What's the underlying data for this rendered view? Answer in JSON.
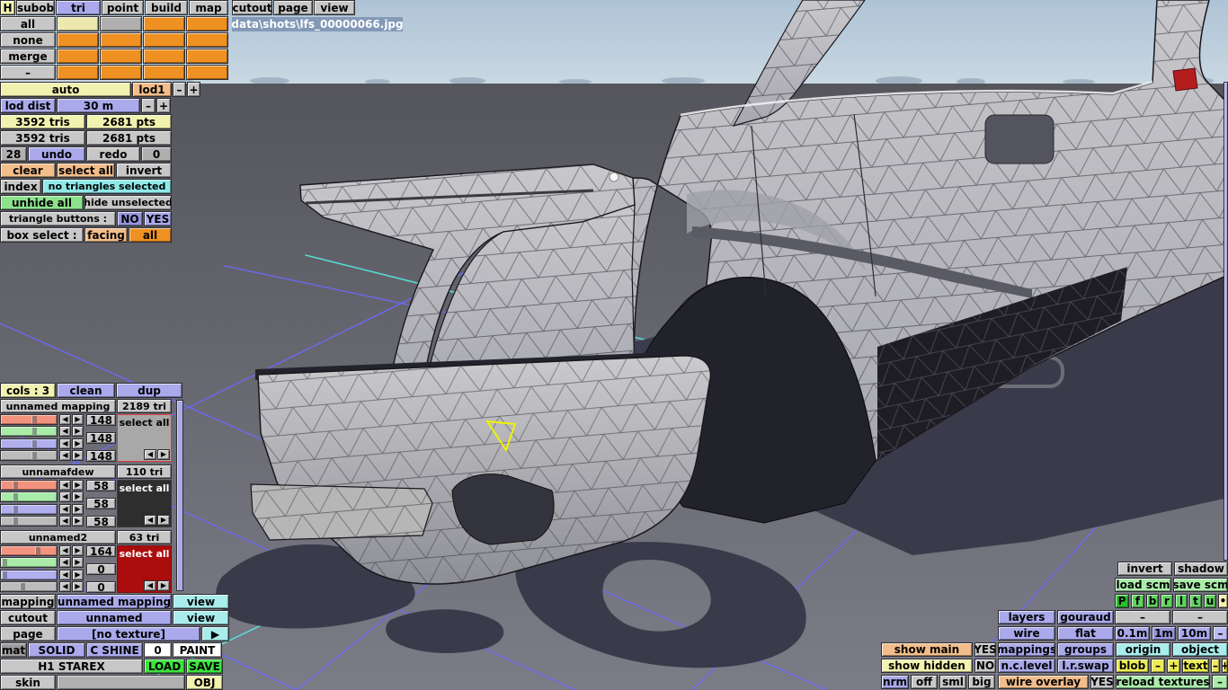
{
  "window": {
    "filename": "data\\shots\\lfs_00000066.jpg"
  },
  "tabs": {
    "h": "H",
    "items": [
      "subob",
      "tri",
      "point",
      "build",
      "map",
      "cutout",
      "page",
      "view"
    ],
    "active": "tri"
  },
  "edit_buttons": {
    "all": "all",
    "none": "none",
    "merge": "merge",
    "dash": "–"
  },
  "lod": {
    "auto": "auto",
    "lod1": "lod1",
    "dist_label": "lod dist",
    "dist_value": "30 m"
  },
  "stats": {
    "tris_a": "3592 tris",
    "pts_a": "2681 pts",
    "tris_b": "3592 tris",
    "pts_b": "2681 pts"
  },
  "history": {
    "undo_count": "28",
    "undo": "undo",
    "redo": "redo",
    "redo_count": "0"
  },
  "selection": {
    "clear": "clear",
    "select_all": "select all",
    "invert": "invert",
    "index": "index",
    "status": "no triangles selected",
    "unhide_all": "unhide all",
    "hide_unselected": "hide unselected",
    "triangle_buttons": "triangle buttons :",
    "no": "NO",
    "yes": "YES",
    "box_select": "box select :",
    "facing": "facing",
    "all": "all"
  },
  "mappings": {
    "cols": "cols : 3",
    "clean": "clean",
    "dup": "dup",
    "groups": [
      {
        "name": "unnamed mapping",
        "tris": "2189 tri",
        "values": [
          "148",
          "148",
          "148"
        ],
        "select_all": "select all"
      },
      {
        "name": "unnamafdew",
        "tris": "110 tri",
        "values": [
          "58",
          "58",
          "58"
        ],
        "select_all": "select all"
      },
      {
        "name": "unnamed2",
        "tris": "63 tri",
        "values": [
          "164",
          "0",
          "0"
        ],
        "select_all": "select all"
      }
    ]
  },
  "object": {
    "mapping": "mapping",
    "mapping_value": "unnamed mapping",
    "view": "view",
    "cutout": "cutout",
    "cutout_value": "unnamed",
    "page": "page",
    "page_value": "[no texture]",
    "mat": "mat",
    "mat_value": "SOLID",
    "shine": "C SHINE",
    "shine_value": "0",
    "paint": "PAINT",
    "car_name": "H1 STAREX",
    "load": "LOAD",
    "save": "SAVE",
    "skin": "skin",
    "obj": "OBJ"
  },
  "view_panel": {
    "invert": "invert",
    "shadow": "shadow",
    "load_scm": "load scm",
    "save_scm": "save scm",
    "axes": [
      "P",
      "f",
      "b",
      "r",
      "l",
      "t",
      "u"
    ],
    "dot": "•",
    "dash": "–",
    "grid_01": "0.1m",
    "grid_1": "1m",
    "grid_10": "10m",
    "layers": "layers",
    "gouraud": "gouraud",
    "wire": "wire",
    "flat": "flat",
    "mappings": "mappings",
    "groups": "groups",
    "origin": "origin",
    "object": "object",
    "nclevel": "n.c.level",
    "lrswap": "l.r.swap",
    "blob": "blob",
    "text": "text",
    "show_main": "show main",
    "show_hidden": "show hidden",
    "yes": "YES",
    "no": "NO",
    "nrm": "nrm",
    "off": "off",
    "sml": "sml",
    "big": "big",
    "wire_overlay": "wire overlay",
    "reload_textures": "reload textures"
  },
  "icons": {
    "left": "◀",
    "right": "▶",
    "minus": "–",
    "plus": "+"
  },
  "colors": {
    "accent_orange": "#ee9022",
    "panel_purple": "#a9a9ec",
    "panel_cyan": "#a9ecec",
    "bright_green": "#3ce43c",
    "light_green": "#abecab",
    "bright_yellow": "#ecec52",
    "peach": "#f2bd8a",
    "select_red": "#ab0c0c",
    "slider_red": "#f2937f",
    "slider_green": "#a9eba9",
    "slider_blue": "#b0b0ee",
    "highlight_yellow": "#f2f200",
    "grid_purple": "#6a6af0",
    "grid_cyan": "#58dfd8",
    "sky": "#b9cdd9",
    "ground": "#6d6d76"
  }
}
